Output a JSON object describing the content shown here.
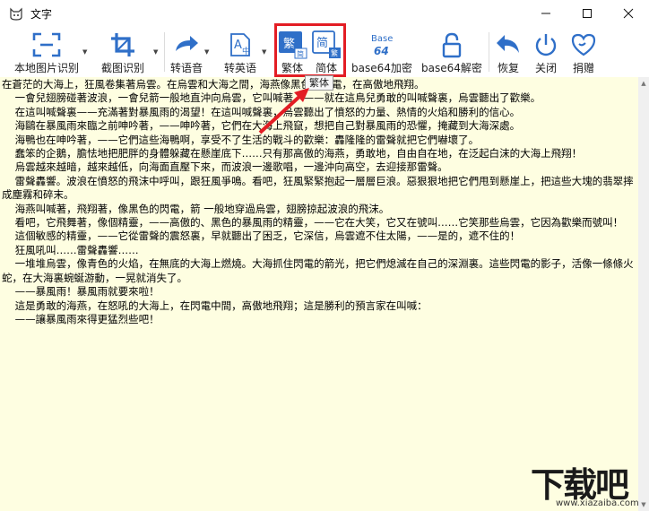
{
  "window": {
    "title": "文字"
  },
  "toolbar": {
    "local_ocr": "本地图片识别",
    "screenshot_ocr": "截图识别",
    "to_speech": "转语音",
    "to_english": "转英语",
    "traditional": "繁体",
    "simplified": "简体",
    "base64_encode": "base64加密",
    "base64_decode": "base64解密",
    "restore": "恢复",
    "close": "关闭",
    "donate": "捐赠",
    "base64_icon_top": "Base",
    "base64_icon_bottom": "64",
    "trad_icon_char": "繁",
    "simp_icon_char": "简",
    "trad_icon_small": "简",
    "simp_icon_small": "繁"
  },
  "tooltip": "繁体",
  "content": {
    "lines": [
      "在蒼茫的大海上，狂風卷集著烏雲。在烏雲和大海之間，海燕像黑色的閃電，在高傲地飛翔。",
      "    一會兒翅膀碰著波浪，一會兒箭一般地直沖向烏雲，它叫喊著，——就在這鳥兒勇敢的叫喊聲裏，烏雲聽出了歡樂。",
      "    在這叫喊聲裏——充滿著對暴風雨的渴望！在這叫喊聲裏，烏雲聽出了憤怒的力量、熱情的火焰和勝利的信心。",
      "    海鷗在暴風雨來臨之前呻吟著，——呻吟著，它們在大海上飛竄，想把自己對暴風雨的恐懼，掩藏到大海深處。",
      "    海鴨也在呻吟著，——它們這些海鴨啊，享受不了生活的戰斗的歡樂：轟隆隆的雷聲就把它們嚇壞了。",
      "    蠢笨的企鵝，膽怯地把肥胖的身體躲藏在懸崖底下……只有那高傲的海燕，勇敢地，自由自在地，在泛起白沫的大海上飛翔！",
      "    烏雲越來越暗，越來越低，向海面直壓下來，而波浪一邊歌唱，一邊沖向高空，去迎接那雷聲。",
      "    雷聲轟響。波浪在憤怒的飛沫中呼叫，跟狂風爭鳴。看吧，狂風緊緊抱起一層層巨浪。惡狠狠地把它們甩到懸崖上，把這些大塊的翡翠摔成塵霧和碎末。",
      "    海燕叫喊著，飛翔著，像黑色的閃電，箭 一般地穿過烏雲，翅膀掠起波浪的飛沫。",
      "    看吧，它飛舞著，像個精靈，——高傲的、黑色的暴風雨的精靈，——它在大笑，它又在號叫……它笑那些烏雲，它因為歡樂而號叫！",
      "    這個敏感的精靈，——它從雷聲的震怒裏，早就聽出了困乏，它深信，烏雲遮不住太陽，——是的，遮不住的！",
      "    狂風吼叫……雷聲轟響……",
      "    一堆堆烏雲，像青色的火焰，在無底的大海上燃燒。大海抓住閃電的箭光，把它們熄滅在自己的深淵裏。這些閃電的影子，活像一條條火蛇，在大海裏蜿蜒游動，一晃就消失了。",
      "    ——暴風雨！暴風雨就要來啦！",
      "    這是勇敢的海燕，在怒吼的大海上，在閃電中間，高傲地飛翔；這是勝利的預言家在叫喊：",
      "    ——讓暴風雨來得更猛烈些吧！"
    ]
  },
  "watermark": {
    "main": "下载吧",
    "sub": "www.xiazaiba.com"
  },
  "colors": {
    "accent": "#2f6fc8",
    "highlight": "#e31d24",
    "content_bg": "#fefee1"
  }
}
